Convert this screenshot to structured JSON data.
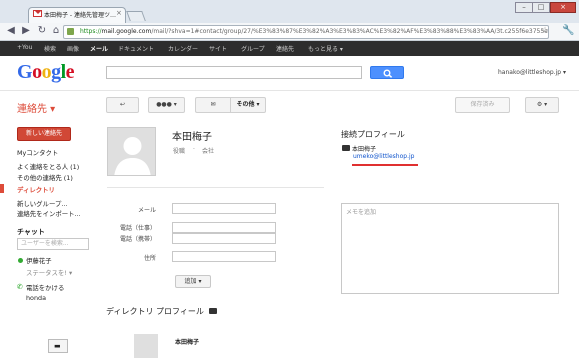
{
  "browser": {
    "tab_title": "本田梅子 - 連絡先管理ツ…",
    "url_scheme": "https://",
    "url_host": "mail.google.com",
    "url_path": "/mail/?shva=1#contact/group/27/%E3%83%87%E3%82%A3%E3%83%AC%E3%82%AF%E3%83%88%E3%83%AA/3t.c255f6e3755e"
  },
  "gbar": [
    "+You",
    "検索",
    "画像",
    "メール",
    "ドキュメント",
    "カレンダー",
    "サイト",
    "グループ",
    "連絡先",
    "もっと見る ▾"
  ],
  "header": {
    "logo": "Google",
    "account": "hanako@littleshop.jp ▾"
  },
  "actions": {
    "app_name": "連絡先 ▾",
    "more": "その他 ▾",
    "save": "保存済み"
  },
  "sidebar": {
    "new_contact": "新しい連絡先",
    "items": [
      "Myコンタクト",
      "よく連絡をとる人 (1)",
      "その他の連絡先 (1)",
      "ディレクトリ",
      "新しいグループ...",
      "連絡先をインポート..."
    ],
    "chat_heading": "チャット",
    "people_search_placeholder": "ユーザーを検索...",
    "chat_user": "伊藤花子",
    "status": "ステータスを!",
    "call_label": "電話をかける",
    "call_user": "honda"
  },
  "contact": {
    "name": "本田梅子",
    "title": "役職",
    "company": "会社",
    "connected_heading": "接続プロフィール",
    "connected_name": "本田梅子",
    "connected_email": "umeko@littleshop.jp",
    "fields": [
      "メール",
      "電話（仕事）",
      "電話（携帯）",
      "住所"
    ],
    "notes_placeholder": "メモを追加",
    "add_button": "追加 ▾",
    "directory_heading": "ディレクトリ プロフィール",
    "directory_name": "本田梅子"
  },
  "colors": {
    "accent_red": "#dd4b39",
    "search_blue": "#4d90fe",
    "link_blue": "#1155cc"
  }
}
